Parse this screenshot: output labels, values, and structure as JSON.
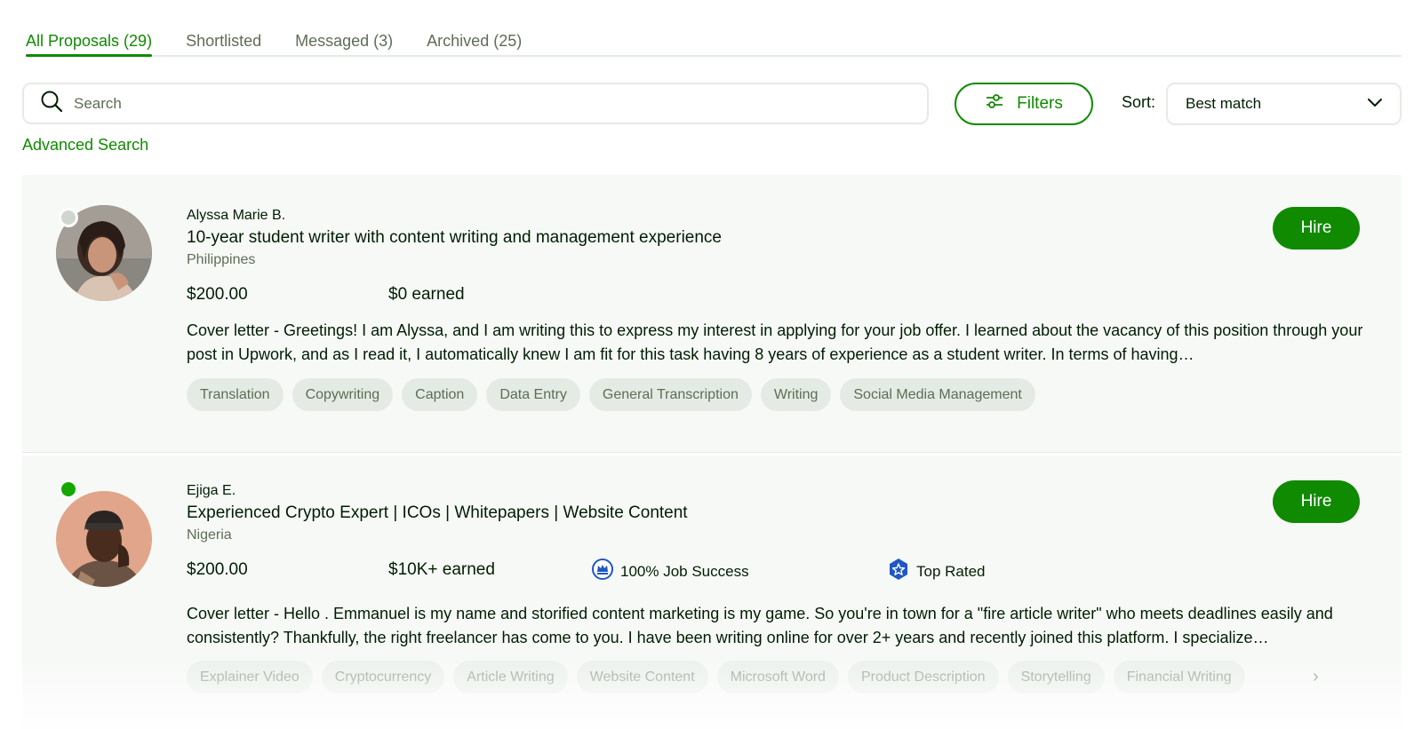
{
  "tabs": [
    {
      "label": "All Proposals (29)",
      "active": true
    },
    {
      "label": "Shortlisted",
      "active": false
    },
    {
      "label": "Messaged (3)",
      "active": false
    },
    {
      "label": "Archived (25)",
      "active": false
    }
  ],
  "search": {
    "placeholder": "Search",
    "value": ""
  },
  "filters": {
    "label": "Filters"
  },
  "sort": {
    "label": "Sort:",
    "selected": "Best match"
  },
  "advanced_search": "Advanced Search",
  "hire_label": "Hire",
  "colors": {
    "brand": "#108a00",
    "card_bg": "#f7f9f7",
    "chip_bg": "#e4ebe4",
    "offline": "#cfd6cf",
    "online": "#14a800",
    "badge_blue": "#1f57c3"
  },
  "proposals": [
    {
      "name": "Alyssa Marie B.",
      "title": "10-year student writer with content writing and management experience",
      "country": "Philippines",
      "rate": "$200.00",
      "earned": "$0 earned",
      "online": false,
      "cover_letter": "Cover letter - Greetings! I am Alyssa, and I am writing this to express my interest in applying for your job offer. I learned about the vacancy of this position through your post in Upwork, and as I read it, I automatically knew I am fit for this task having 8 years of experience as a student writer. In terms of having…",
      "skills": [
        "Translation",
        "Copywriting",
        "Caption",
        "Data Entry",
        "General Transcription",
        "Writing",
        "Social Media Management"
      ]
    },
    {
      "name": "Ejiga E.",
      "title": "Experienced Crypto Expert | ICOs | Whitepapers | Website Content",
      "country": "Nigeria",
      "rate": "$200.00",
      "earned": "$10K+ earned",
      "job_success": "100% Job Success",
      "top_rated": "Top Rated",
      "online": true,
      "cover_letter": "Cover letter - Hello . Emmanuel is my name and storified content marketing is my game. So you're in town for a \"fire article writer\" who meets deadlines easily and consistently? Thankfully, the right freelancer has come to you. I have been writing online for over 2+ years and recently joined this platform. I specialize…",
      "skills": [
        "Explainer Video",
        "Cryptocurrency",
        "Article Writing",
        "Website Content",
        "Microsoft Word",
        "Product Description",
        "Storytelling",
        "Financial Writing"
      ]
    }
  ]
}
